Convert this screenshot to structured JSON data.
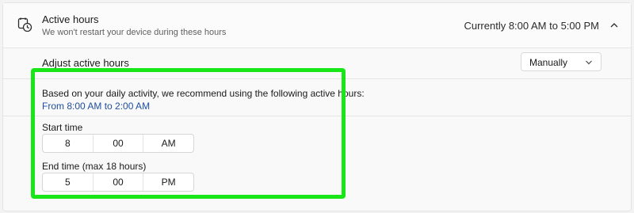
{
  "header": {
    "title": "Active hours",
    "subtitle": "We won't restart your device during these hours",
    "status": "Currently 8:00 AM to 5:00 PM",
    "icon": "clock-settings-icon"
  },
  "adjust": {
    "label": "Adjust active hours",
    "mode": "Manually"
  },
  "recommendation": {
    "text": "Based on your daily activity, we recommend using the following active hours:",
    "range": "From 8:00 AM to 2:00 AM"
  },
  "start": {
    "label": "Start time",
    "hour": "8",
    "minute": "00",
    "period": "AM"
  },
  "end": {
    "label": "End time (max 18 hours)",
    "hour": "5",
    "minute": "00",
    "period": "PM"
  },
  "colors": {
    "highlight": "#19e619",
    "link": "#1f4e9e"
  }
}
